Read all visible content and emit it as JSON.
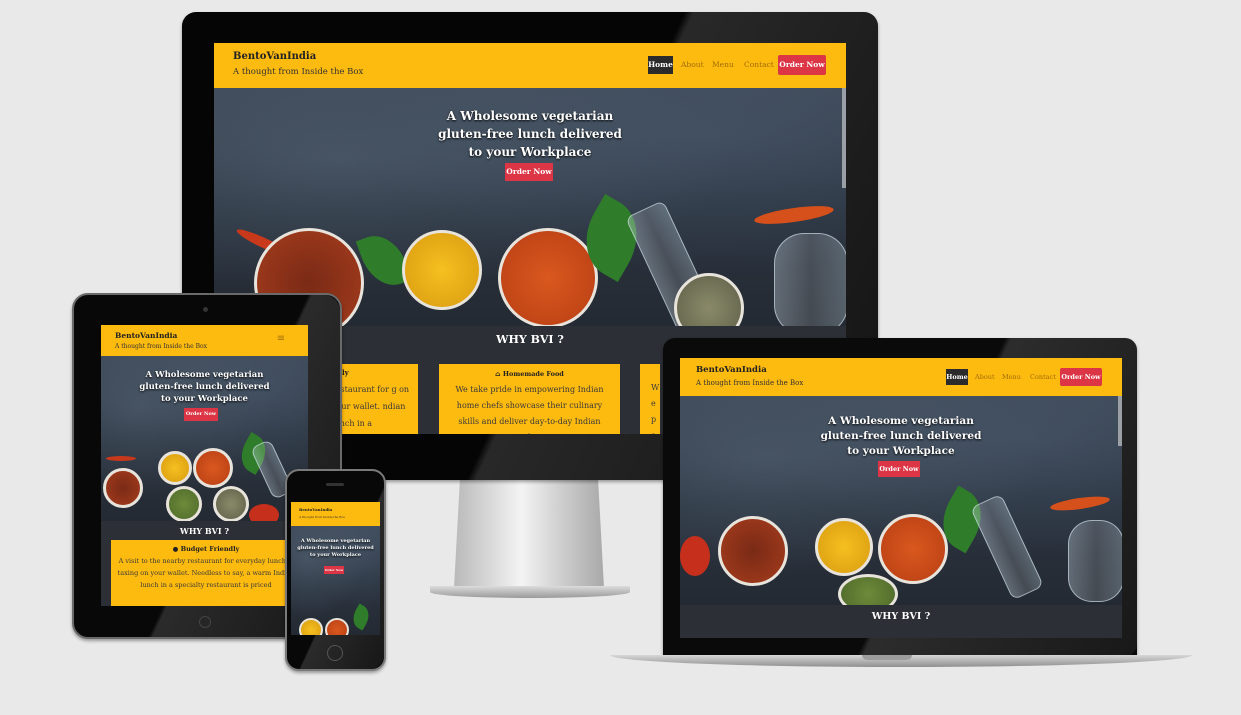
{
  "site": {
    "brand": "BentoVanIndia",
    "tagline": "A thought from Inside the Box",
    "nav": {
      "home": "Home",
      "about": "About",
      "menu": "Menu",
      "contact": "Contact",
      "cta": "Order Now"
    },
    "hamburger": "≡",
    "hero": {
      "line1": "A Wholesome vegetarian",
      "line2": "gluten-free lunch delivered",
      "line3": "to your Workplace",
      "button": "Order Now"
    },
    "why_heading": "WHY BVI ?",
    "cards": {
      "budget": {
        "icon": "piggy-bank-icon",
        "title": "Budget Friendly",
        "title_partial": "ndly",
        "text_tablet": "A visit to the nearby restaurant for everyday lunch is taxing on your wallet. Needless to say, a warm Indian lunch in a specialty restaurant is priced",
        "text_desktop_partial": "restaurant for g on your wallet. ndian lunch in a"
      },
      "homemade": {
        "icon": "home-icon",
        "title": "Homemade Food",
        "text": "We take pride in empowering Indian home chefs showcase their culinary skills and deliver day-to-day Indian staple.As"
      },
      "third_partial": "We p col"
    }
  },
  "colors": {
    "nav_bg": "#fdba0f",
    "accent_red": "#dc3545",
    "dark_section": "#2c2f36",
    "page_bg": "#e9e9e9"
  }
}
